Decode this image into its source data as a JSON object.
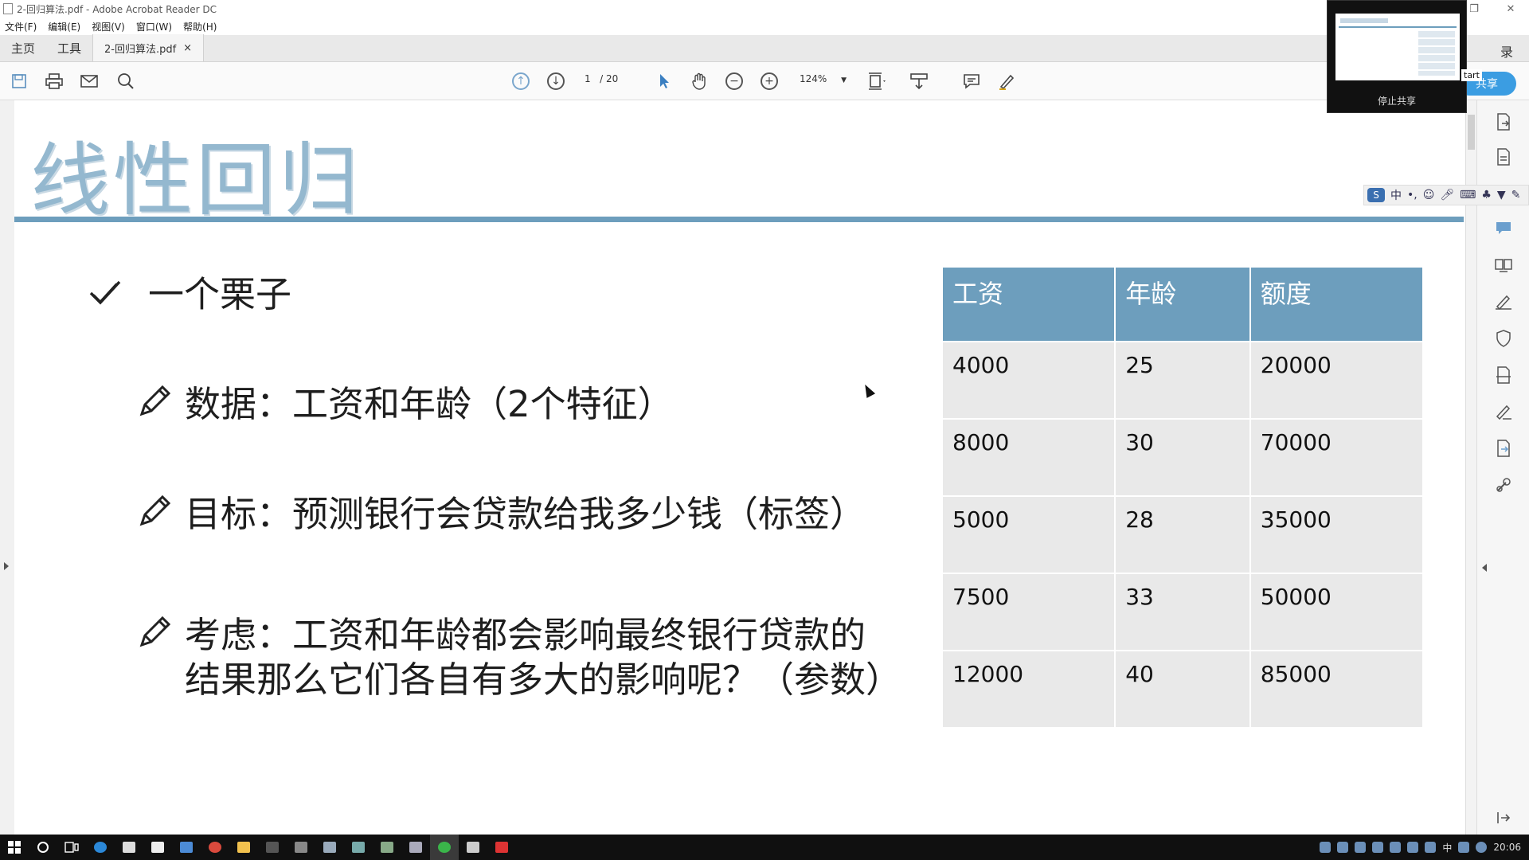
{
  "window": {
    "title": "2-回归算法.pdf - Adobe Acrobat Reader DC",
    "controls": [
      "—",
      "❐",
      "✕"
    ]
  },
  "menu": [
    "文件(F)",
    "编辑(E)",
    "视图(V)",
    "窗口(W)",
    "帮助(H)"
  ],
  "tabs": {
    "home": "主页",
    "tools": "工具",
    "document": "2-回归算法.pdf",
    "close": "×",
    "right_label": "录"
  },
  "toolbar": {
    "page_current": "1",
    "page_total": "/ 20",
    "zoom": "124%",
    "share_label": "共享"
  },
  "slide": {
    "title": "线性回归",
    "bullet_example": "一个栗子",
    "bullet_data": "数据：工资和年龄（2个特征）",
    "bullet_goal": "目标：预测银行会贷款给我多少钱（标签）",
    "bullet_consider_1": "考虑：工资和年龄都会影响最终银行贷款的",
    "bullet_consider_2": "结果那么它们各自有多大的影响呢？（参数）"
  },
  "table": {
    "headers": [
      "工资",
      "年龄",
      "额度"
    ],
    "rows": [
      [
        "4000",
        "25",
        "20000"
      ],
      [
        "8000",
        "30",
        "70000"
      ],
      [
        "5000",
        "28",
        "35000"
      ],
      [
        "7500",
        "33",
        "50000"
      ],
      [
        "12000",
        "40",
        "85000"
      ]
    ]
  },
  "ime": {
    "label_zh": "中",
    "label_punct": "•,"
  },
  "share_overlay": {
    "stop_label": "停止共享",
    "start_label": "tart"
  },
  "taskbar": {
    "clock": "20:06",
    "tray_lang": "中"
  },
  "colors": {
    "accent_blue": "#6d9ebd",
    "title_blue": "#94b8cf",
    "table_cell": "#e9e9e9",
    "share_button": "#3b9de2"
  }
}
